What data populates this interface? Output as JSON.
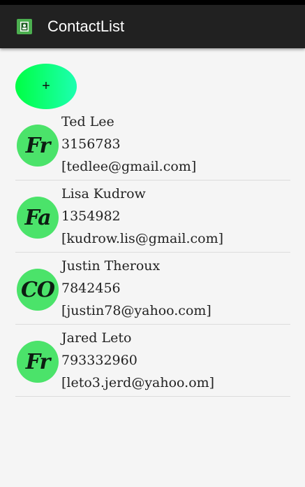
{
  "app": {
    "title": "ContactList",
    "icon": "contact-book-icon",
    "accent": "#4caf50",
    "toolbar_color": "#212121"
  },
  "add_button": {
    "label": "+",
    "colors": [
      "#00ff44",
      "#1cffb0"
    ]
  },
  "contacts": [
    {
      "avatar": "Fr",
      "name": "Ted Lee",
      "phone": "3156783",
      "email": "[tedlee@gmail.com]"
    },
    {
      "avatar": "Fa",
      "name": "Lisa Kudrow",
      "phone": "1354982",
      "email": "[kudrow.lis@gmail.com]"
    },
    {
      "avatar": "CO",
      "name": "Justin Theroux",
      "phone": "7842456",
      "email": "[justin78@yahoo.com]"
    },
    {
      "avatar": "Fr",
      "name": "Jared Leto",
      "phone": "793332960",
      "email": "[leto3.jerd@yahoo.om]"
    }
  ],
  "avatar_color": "#4be36a"
}
